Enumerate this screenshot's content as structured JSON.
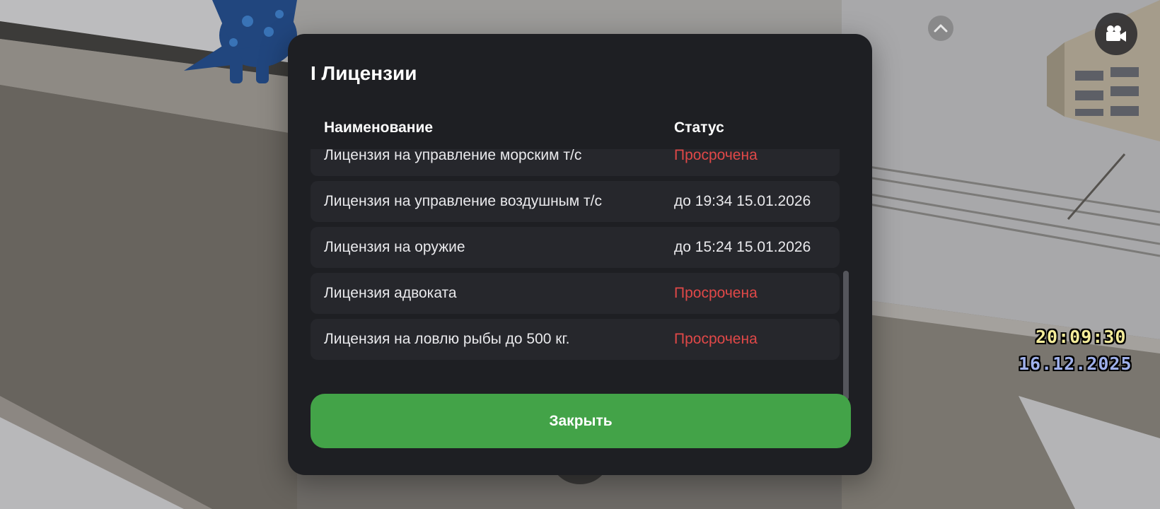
{
  "modal": {
    "title": "I Лицензии",
    "columns": {
      "name": "Наименование",
      "status": "Статус"
    },
    "rows": [
      {
        "name": "Лицензия на управление морским т/с",
        "status": "Просрочена",
        "state": "expired"
      },
      {
        "name": "Лицензия на управление воздушным т/с",
        "status": "до 19:34 15.01.2026",
        "state": "ok"
      },
      {
        "name": "Лицензия на оружие",
        "status": "до 15:24 15.01.2026",
        "state": "ok"
      },
      {
        "name": "Лицензия адвоката",
        "status": "Просрочена",
        "state": "expired"
      },
      {
        "name": "Лицензия на ловлю рыбы до 500 кг.",
        "status": "Просрочена",
        "state": "expired"
      }
    ],
    "close_label": "Закрыть"
  },
  "hud": {
    "time": "20:09:30",
    "date": "16.12.2025",
    "collapse_icon": "chevron-up-icon",
    "camera_icon": "video-camera-icon"
  },
  "colors": {
    "panel_bg": "#1e1f23",
    "row_bg": "#26272c",
    "expired": "#e04848",
    "close_button": "#43a348",
    "clock_time": "#f4ec9a",
    "clock_date": "#9fb0ea"
  }
}
